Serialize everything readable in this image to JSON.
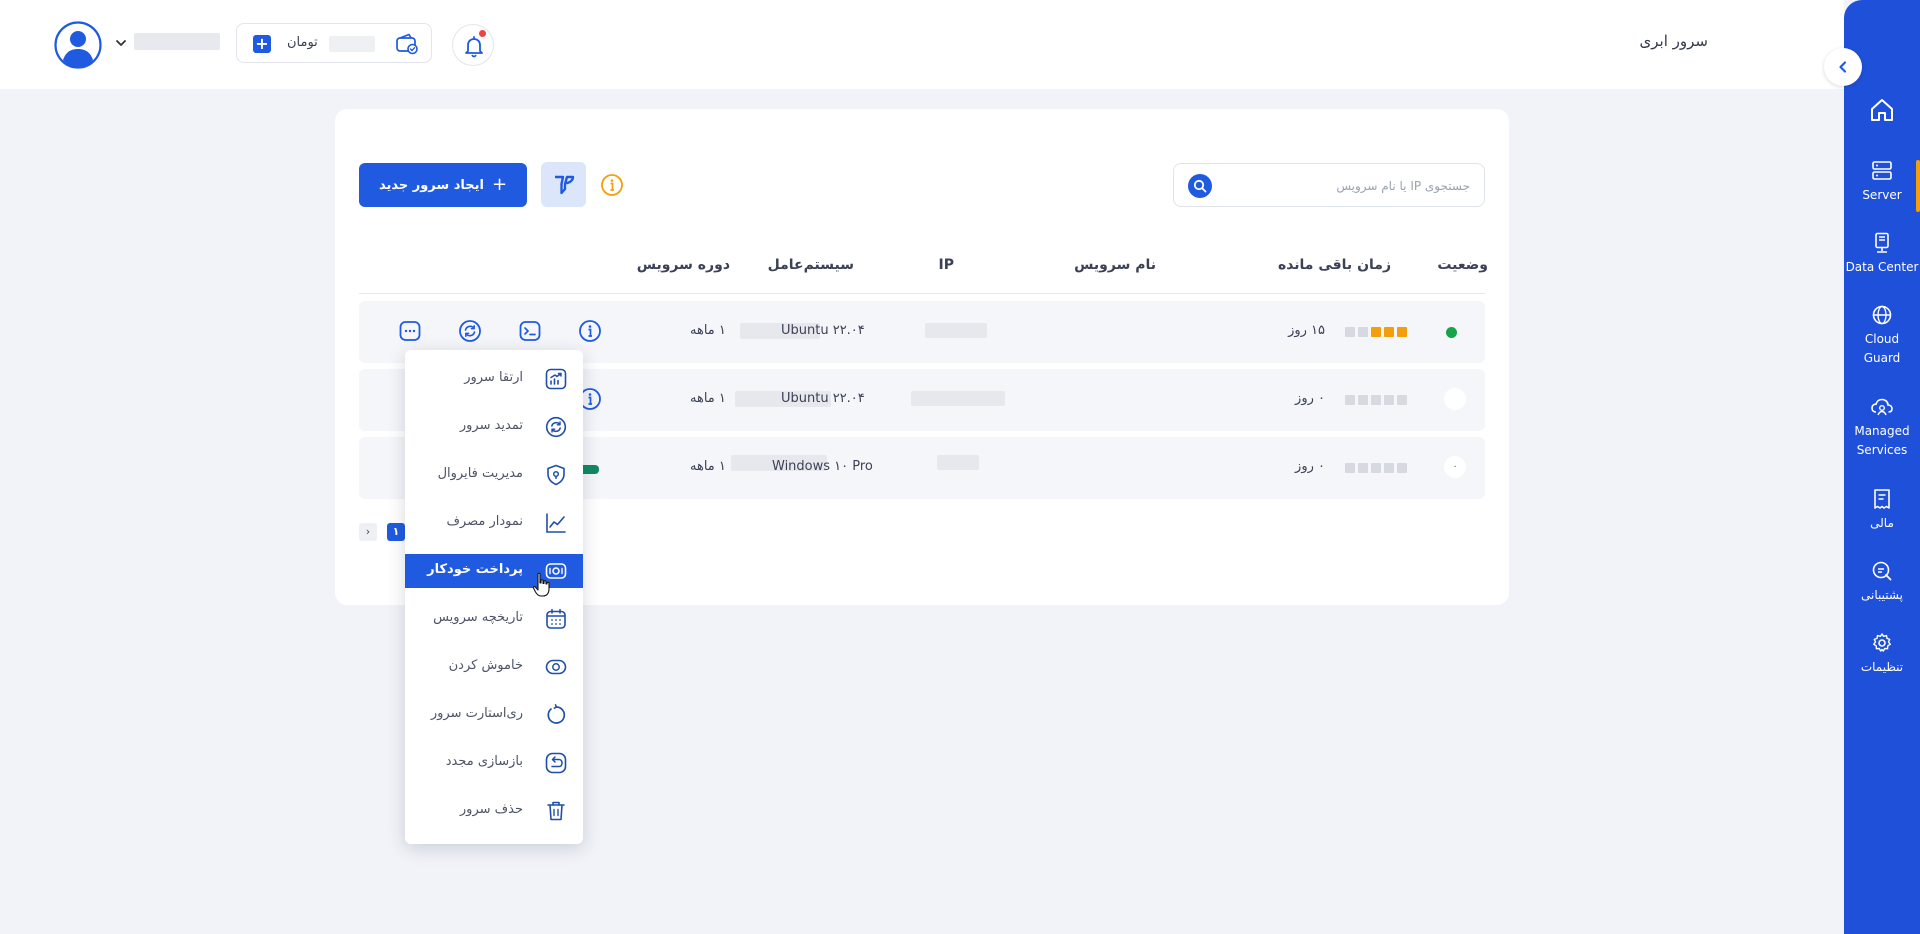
{
  "header": {
    "page_title": "سرور ابری",
    "wallet": {
      "currency": "تومان"
    },
    "notifications": {
      "has_unread": true
    }
  },
  "sidebar": {
    "items": [
      {
        "label": "",
        "icon": "home-icon"
      },
      {
        "label": "Server",
        "icon": "server-icon",
        "active": true
      },
      {
        "label": "Data Center",
        "icon": "data-center-icon"
      },
      {
        "label": "Cloud Guard",
        "icon": "globe-icon"
      },
      {
        "label": "Managed Services",
        "icon": "cloud-user-icon"
      },
      {
        "label": "مالی",
        "icon": "receipt-icon"
      },
      {
        "label": "پشتیبانی",
        "icon": "chat-icon"
      },
      {
        "label": "تنظیمات",
        "icon": "gear-icon"
      }
    ],
    "accent_color": "#f59e0b",
    "bg_color": "#1f50d9"
  },
  "toolbar": {
    "search_placeholder": "جستجوی IP یا نام سرویس",
    "create_label": "ایجاد سرور جدید",
    "create_plus": "+"
  },
  "table": {
    "columns": [
      "وضعیت",
      "زمان باقی مانده",
      "نام سرویس",
      "IP",
      "سیستم‌عامل",
      "دوره سرویس"
    ],
    "rows": [
      {
        "status": "on",
        "remaining": "۱۵ روز",
        "os": "Ubuntu ۲۲.۰۴",
        "period": "۱ ماهه",
        "remaining_level": 3
      },
      {
        "status": "empty",
        "remaining": "۰ روز",
        "os": "Ubuntu ۲۲.۰۴",
        "period": "۱ ماهه",
        "remaining_level": 0
      },
      {
        "status": "loading",
        "status_text": "۰",
        "remaining": "۰ روز",
        "os": "Windows ۱۰ Pro",
        "period": "۱ ماهه",
        "remaining_level": 0
      }
    ]
  },
  "pagination": {
    "current": "۱",
    "prev": "›"
  },
  "menu": {
    "items": [
      {
        "label": "ارتقا سرور",
        "icon": "upgrade-chart-icon"
      },
      {
        "label": "تمدید سرور",
        "icon": "renew-icon"
      },
      {
        "label": "مدیریت فایروال",
        "icon": "shield-icon"
      },
      {
        "label": "نمودار مصرف",
        "icon": "line-chart-icon"
      },
      {
        "label": "پرداخت خودکار",
        "icon": "money-icon",
        "active": true
      },
      {
        "label": "تاریخچه سرویس",
        "icon": "calendar-icon"
      },
      {
        "label": "خاموش کردن",
        "icon": "power-toggle-icon"
      },
      {
        "label": "ری‌استارت سرور",
        "icon": "restart-icon"
      },
      {
        "label": "بازسازی مجدد",
        "icon": "rebuild-icon"
      },
      {
        "label": "حذف سرور",
        "icon": "trash-icon"
      }
    ]
  },
  "colors": {
    "primary": "#1f5ae0",
    "status_on": "#16a34a",
    "remaining_filled": "#f59e0b",
    "remaining_empty": "#d6d9e0",
    "info_orange": "#f59e0b"
  }
}
